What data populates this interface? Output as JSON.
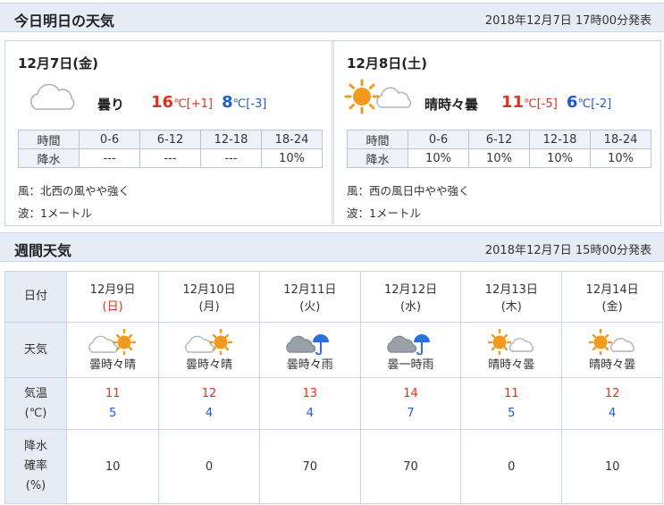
{
  "today_header": {
    "title": "今日明日の天気",
    "published": "2018年12月7日 17時00分発表"
  },
  "today": {
    "date": "12月7日(金)",
    "icon": "cloudy-icon",
    "weather": "曇り",
    "high": "16",
    "high_unit": "℃",
    "high_diff": "[+1]",
    "low": "8",
    "low_unit": "℃",
    "low_diff": "[-3]",
    "precip_header": [
      "時間",
      "0-6",
      "6-12",
      "12-18",
      "18-24"
    ],
    "precip_row": [
      "降水",
      "---",
      "---",
      "---",
      "10%"
    ],
    "wind": "風：北西の風やや強く",
    "wave": "波：1メートル"
  },
  "tomorrow": {
    "date": "12月8日(土)",
    "icon": "sunny-then-cloudy-icon",
    "weather": "晴時々曇",
    "high": "11",
    "high_unit": "℃",
    "high_diff": "[-5]",
    "low": "6",
    "low_unit": "℃",
    "low_diff": "[-2]",
    "precip_header": [
      "時間",
      "0-6",
      "6-12",
      "12-18",
      "18-24"
    ],
    "precip_row": [
      "降水",
      "10%",
      "10%",
      "10%",
      "10%"
    ],
    "wind": "風：西の風日中やや強く",
    "wave": "波：1メートル"
  },
  "week_header": {
    "title": "週間天気",
    "published": "2018年12月7日 15時00分発表"
  },
  "week": {
    "row_labels": {
      "date": "日付",
      "weather": "天気",
      "temp1": "気温",
      "temp2": "(℃)",
      "precip1": "降水",
      "precip2": "確率",
      "precip3": "(%)"
    },
    "days": [
      {
        "date": "12月9日",
        "dow": "(日)",
        "sunday": true,
        "icon": "cloudy-sunny-icon",
        "weather": "曇時々晴",
        "high": "11",
        "low": "5",
        "precip": "10"
      },
      {
        "date": "12月10日",
        "dow": "(月)",
        "sunday": false,
        "icon": "cloudy-sunny-icon",
        "weather": "曇時々晴",
        "high": "12",
        "low": "4",
        "precip": "0"
      },
      {
        "date": "12月11日",
        "dow": "(火)",
        "sunday": false,
        "icon": "cloudy-rain-icon",
        "weather": "曇時々雨",
        "high": "13",
        "low": "4",
        "precip": "70"
      },
      {
        "date": "12月12日",
        "dow": "(水)",
        "sunday": false,
        "icon": "cloudy-rain-icon",
        "weather": "曇一時雨",
        "high": "14",
        "low": "7",
        "precip": "70"
      },
      {
        "date": "12月13日",
        "dow": "(木)",
        "sunday": false,
        "icon": "sunny-cloudy-icon",
        "weather": "晴時々曇",
        "high": "11",
        "low": "5",
        "precip": "0"
      },
      {
        "date": "12月14日",
        "dow": "(金)",
        "sunday": false,
        "icon": "sunny-cloudy-icon",
        "weather": "晴時々曇",
        "high": "12",
        "low": "4",
        "precip": "10"
      }
    ]
  },
  "colors": {
    "high": "#e0301e",
    "low": "#1c5bd6",
    "header_bg": "#e6ecf5",
    "sun": "#f29a1f",
    "umbrella": "#2f6fe0"
  }
}
